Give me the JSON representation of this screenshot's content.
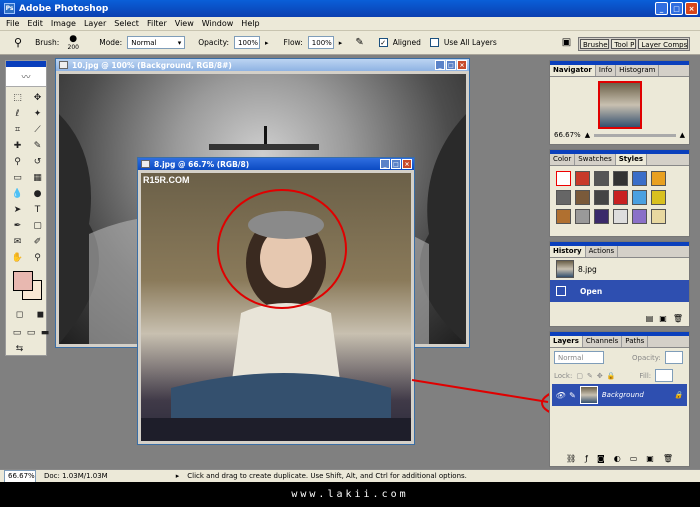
{
  "app": {
    "title": "Adobe Photoshop"
  },
  "menu": [
    "File",
    "Edit",
    "Image",
    "Layer",
    "Select",
    "Filter",
    "View",
    "Window",
    "Help"
  ],
  "options": {
    "brush_label": "Brush:",
    "brush_size": "200",
    "mode_label": "Mode:",
    "mode_value": "Normal",
    "opacity_label": "Opacity:",
    "opacity_value": "100%",
    "flow_label": "Flow:",
    "flow_value": "100%",
    "aligned_label": "Aligned",
    "use_all_layers_label": "Use All Layers"
  },
  "palette_well": [
    "Brushe",
    "Tool P",
    "Layer Comps"
  ],
  "documents": [
    {
      "title": "10.jpg @ 100% (Background, RGB/8#)"
    },
    {
      "title": "8.jpg @ 66.7% (RGB/8)",
      "watermark": "R15R.COM"
    }
  ],
  "panels": {
    "navigator": {
      "tabs": [
        "Navigator",
        "Info",
        "Histogram"
      ],
      "zoom": "66.67%"
    },
    "swatches": {
      "tabs": [
        "Color",
        "Swatches",
        "Styles"
      ]
    },
    "history": {
      "tabs": [
        "History",
        "Actions"
      ],
      "snapshot": "8.jpg",
      "step": "Open"
    },
    "layers": {
      "tabs": [
        "Layers",
        "Channels",
        "Paths"
      ],
      "blend": "Normal",
      "opacity_label": "Opacity:",
      "lock_label": "Lock:",
      "fill_label": "Fill:",
      "layer_name": "Background"
    }
  },
  "status": {
    "zoom": "66.67%",
    "doc": "Doc: 1.03M/1.03M",
    "hint": "Click and drag to create duplicate. Use Shift, Alt, and Ctrl for additional options."
  },
  "footer": {
    "text": "www.lakii.com"
  }
}
